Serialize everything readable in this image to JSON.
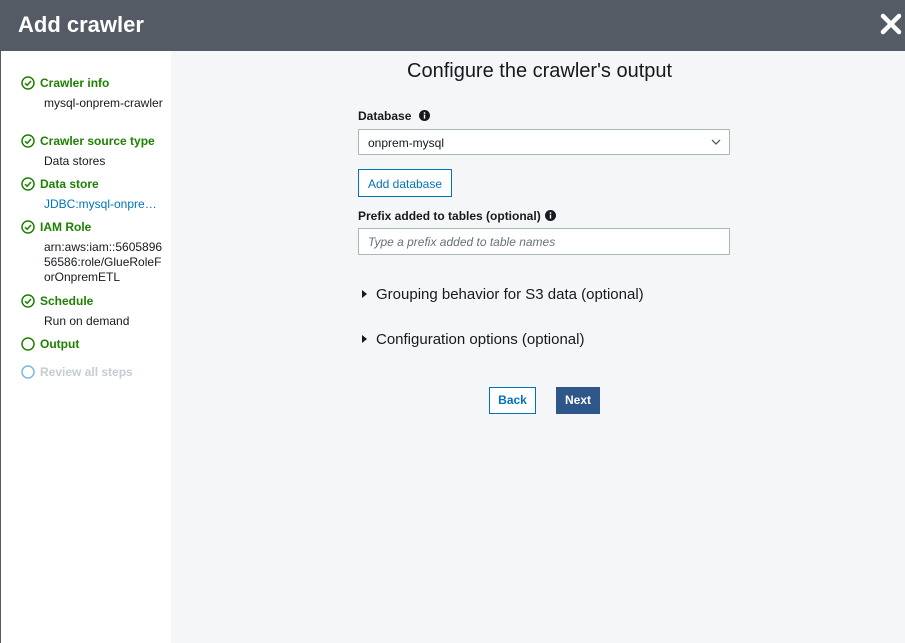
{
  "window": {
    "title": "Add crawler",
    "close_icon": "close-icon"
  },
  "sidebar": {
    "steps": [
      {
        "label": "Crawler info",
        "status": "complete",
        "detail": "mysql-onprem-crawler"
      },
      {
        "label": "Crawler source type",
        "status": "complete",
        "detail": "Data stores"
      },
      {
        "label": "Data store",
        "status": "complete",
        "detail": "JDBC:mysql-onprem-connection"
      },
      {
        "label": "IAM Role",
        "status": "complete",
        "detail": "arn:aws:iam::560589656586:role/GlueRoleForOnpremETL"
      },
      {
        "label": "Schedule",
        "status": "complete",
        "detail": "Run on demand"
      },
      {
        "label": "Output",
        "status": "current"
      },
      {
        "label": "Review all steps",
        "status": "pending"
      }
    ]
  },
  "main": {
    "heading": "Configure the crawler's output",
    "database": {
      "label": "Database",
      "value": "onprem-mysql"
    },
    "add_database_label": "Add database",
    "prefix": {
      "label": "Prefix added to tables (optional)",
      "placeholder": "Type a prefix added to table names"
    },
    "sections": [
      {
        "label": "Grouping behavior for S3 data (optional)"
      },
      {
        "label": "Configuration options (optional)"
      }
    ],
    "buttons": {
      "back": "Back",
      "next": "Next"
    }
  },
  "colors": {
    "header": "#545b64",
    "success": "#1d8102",
    "link": "#0073bb",
    "primary": "#2e5688",
    "pending": "#c5ccd3"
  }
}
